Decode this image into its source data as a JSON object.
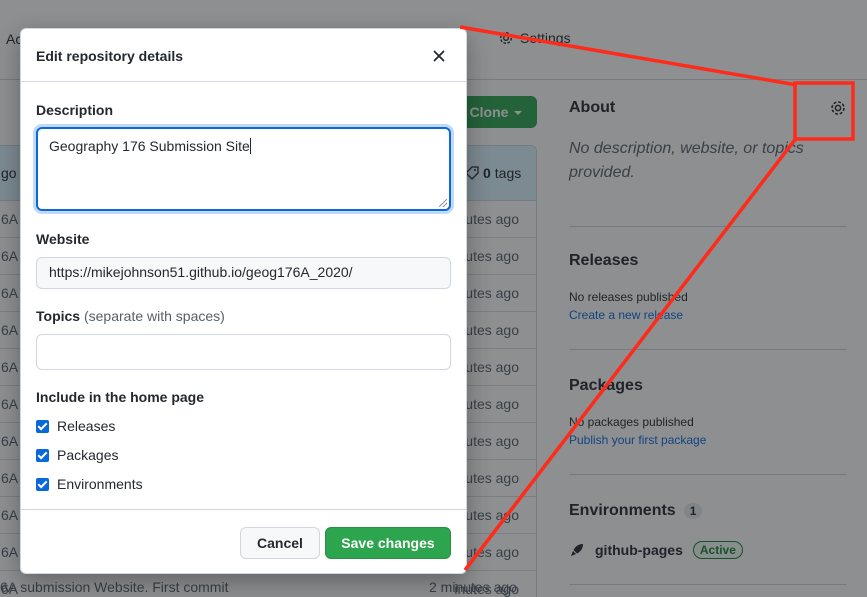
{
  "colors": {
    "accent": "#0969da",
    "primary_button": "#2da44e",
    "annotation": "#ff2a1a",
    "success": "#1a7f37"
  },
  "background": {
    "nav": {
      "actions_tab_partial": "Ac",
      "settings_tab": "Settings",
      "settings_icon": "gear-icon"
    },
    "clone_button": "Clone",
    "file_header": {
      "ago_partial": "go",
      "tags_count": "0",
      "tags_label": "tags"
    },
    "file_rows": [
      {
        "name": "6A",
        "age": "inutes ago"
      },
      {
        "name": "6A",
        "age": "inutes ago"
      },
      {
        "name": "6A",
        "age": "inutes ago"
      },
      {
        "name": "6A",
        "age": "inutes ago"
      },
      {
        "name": "6A",
        "age": "inutes ago"
      },
      {
        "name": "6A",
        "age": "inutes ago"
      },
      {
        "name": "6A",
        "age": "inutes ago"
      },
      {
        "name": "6A",
        "age": "inutes ago"
      },
      {
        "name": "6A",
        "age": "inutes ago"
      },
      {
        "name": "6A",
        "age": "inutes ago"
      },
      {
        "name": "6A",
        "age": "inutes ago"
      }
    ],
    "commit": {
      "message": "6A submission Website. First commit",
      "age": "2 minutes ago"
    },
    "sidebar": {
      "about_title": "About",
      "about_description": "No description, website, or topics provided.",
      "releases_title": "Releases",
      "releases_note": "No releases published",
      "releases_link": "Create a new release",
      "packages_title": "Packages",
      "packages_note": "No packages published",
      "packages_link": "Publish your first package",
      "environments_title": "Environments",
      "environments_count": "1",
      "environment_name": "github-pages",
      "environment_status": "Active"
    }
  },
  "dialog": {
    "title": "Edit repository details",
    "close_icon": "close-icon",
    "description_label": "Description",
    "description_value": "Geography 176 Submission Site",
    "website_label": "Website",
    "website_value": "https://mikejohnson51.github.io/geog176A_2020/",
    "topics_label": "Topics",
    "topics_hint": "(separate with spaces)",
    "topics_value": "",
    "home_page_label": "Include in the home page",
    "checkboxes": [
      {
        "label": "Releases",
        "checked": true
      },
      {
        "label": "Packages",
        "checked": true
      },
      {
        "label": "Environments",
        "checked": true
      }
    ],
    "cancel_label": "Cancel",
    "save_label": "Save changes"
  }
}
